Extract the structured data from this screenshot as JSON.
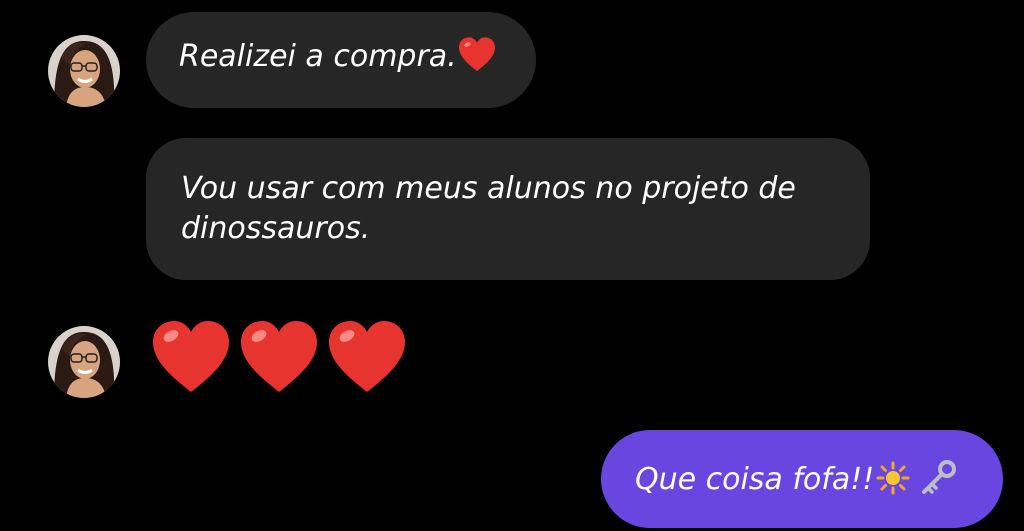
{
  "conversation": {
    "messages": [
      {
        "sender": "contact",
        "text": "Realizei a compra.",
        "trailing_icon": "red-heart-icon"
      },
      {
        "sender": "contact",
        "text": "Vou usar com meus alunos no projeto de dinossauros."
      },
      {
        "sender": "contact",
        "emoji": [
          "red-heart-icon",
          "red-heart-icon",
          "red-heart-icon"
        ]
      },
      {
        "sender": "me",
        "text": "Que coisa fofa!!",
        "trailing_icons": [
          "sun-icon",
          "key-icon"
        ]
      }
    ]
  },
  "colors": {
    "background": "#000000",
    "incoming_bubble": "#262626",
    "outgoing_bubble": "#6a46e0",
    "text": "#ffffff",
    "heart": "#e8342f"
  }
}
